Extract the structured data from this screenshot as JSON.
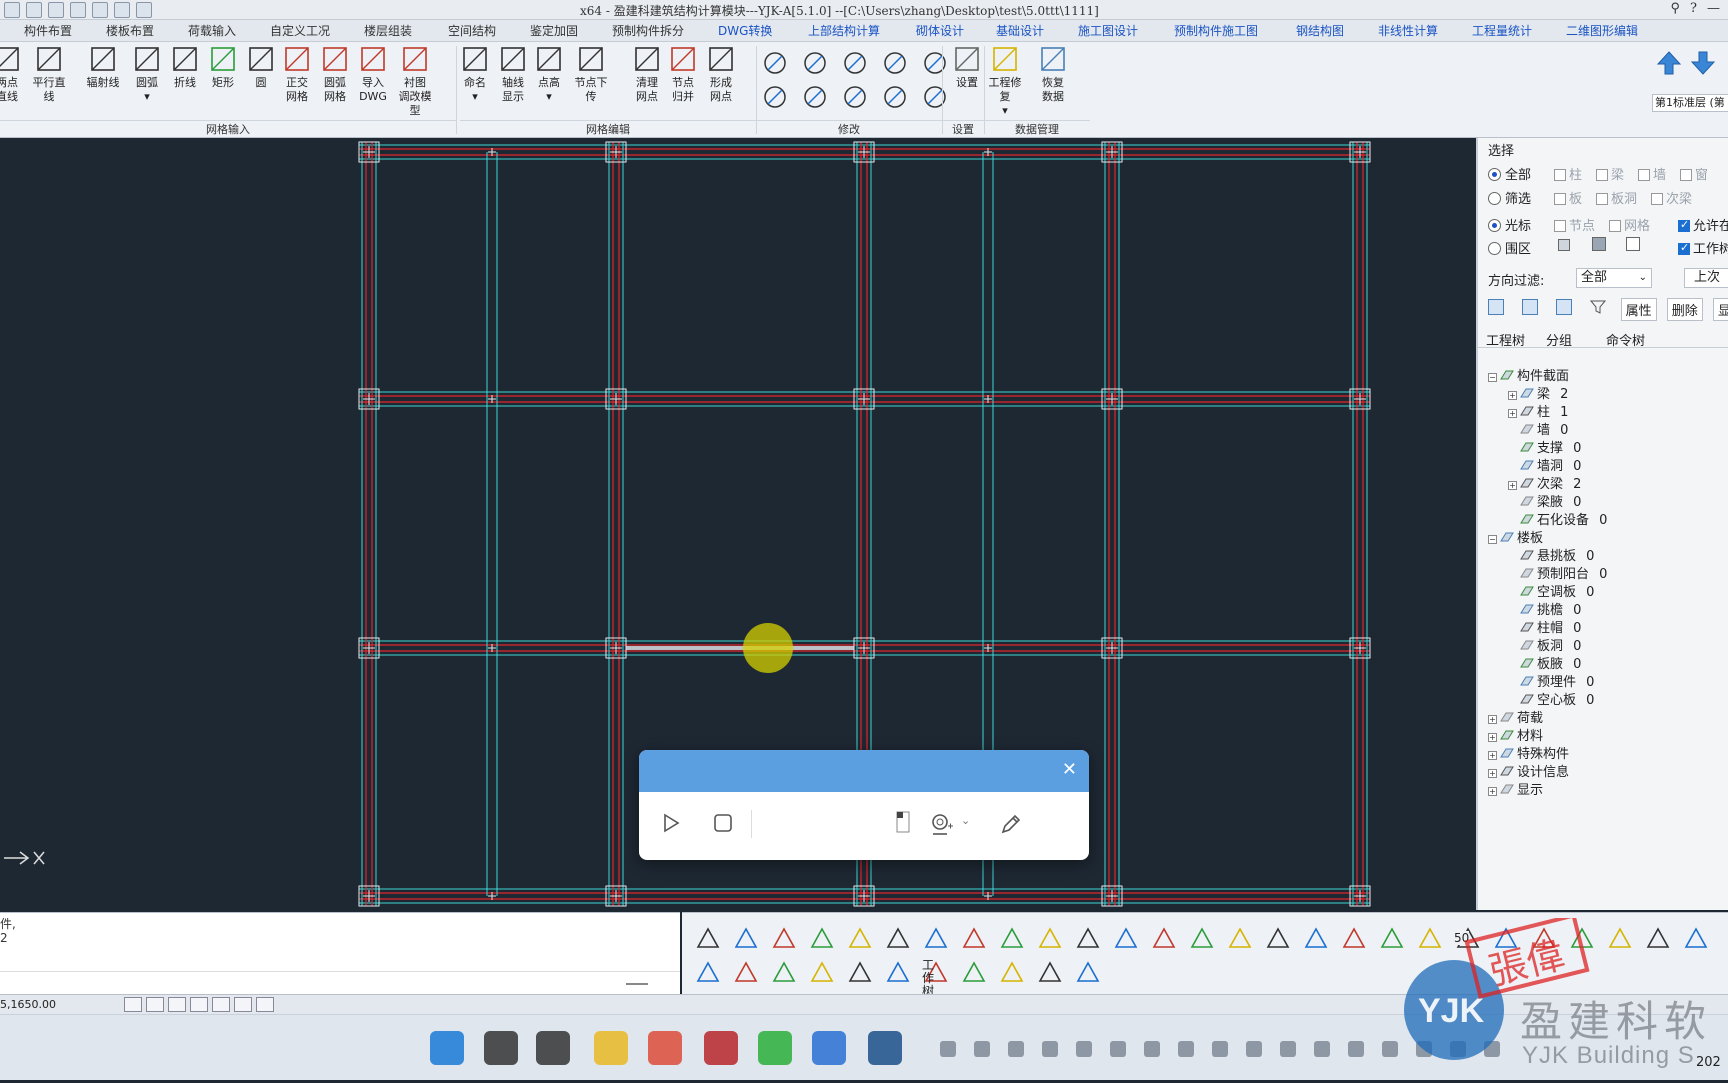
{
  "window": {
    "title": "x64 - 盈建科建筑结构计算模块---YJK-A[5.1.0] --[C:\\Users\\zhang\\Desktop\\test\\5.0ttt\\1111]"
  },
  "menu": [
    {
      "label": "构件布置",
      "active": false
    },
    {
      "label": "楼板布置",
      "active": false
    },
    {
      "label": "荷载输入",
      "active": false
    },
    {
      "label": "自定义工况",
      "active": false
    },
    {
      "label": "楼层组装",
      "active": false
    },
    {
      "label": "空间结构",
      "active": false
    },
    {
      "label": "鉴定加固",
      "active": false
    },
    {
      "label": "预制构件拆分",
      "active": false
    },
    {
      "label": "DWG转换",
      "active": true
    },
    {
      "label": "上部结构计算",
      "active": true
    },
    {
      "label": "砌体设计",
      "active": true
    },
    {
      "label": "基础设计",
      "active": true
    },
    {
      "label": "施工图设计",
      "active": true
    },
    {
      "label": "预制构件施工图",
      "active": true
    },
    {
      "label": "钢结构图",
      "active": true
    },
    {
      "label": "非线性计算",
      "active": true
    },
    {
      "label": "工程量统计",
      "active": true
    },
    {
      "label": "二维图形编辑",
      "active": true
    }
  ],
  "ribbon": {
    "tools": [
      {
        "id": "two-point-line",
        "label1": "两点",
        "label2": "直线"
      },
      {
        "id": "parallel-line",
        "label1": "平行直线",
        "label2": ""
      },
      {
        "id": "radial-line",
        "label1": "辐射线",
        "label2": ""
      },
      {
        "id": "arc",
        "label1": "圆弧",
        "label2": "▾"
      },
      {
        "id": "polyline",
        "label1": "折线",
        "label2": ""
      },
      {
        "id": "rectangle",
        "label1": "矩形",
        "label2": ""
      },
      {
        "id": "circle",
        "label1": "圆",
        "label2": ""
      },
      {
        "id": "ortho-grid",
        "label1": "正交",
        "label2": "网格"
      },
      {
        "id": "arc-grid",
        "label1": "圆弧",
        "label2": "网格"
      },
      {
        "id": "import-dwg",
        "label1": "导入",
        "label2": "DWG"
      },
      {
        "id": "base-model",
        "label1": "衬图",
        "label2": "调改模型"
      },
      {
        "id": "name",
        "label1": "命名",
        "label2": "▾"
      },
      {
        "id": "axis-display",
        "label1": "轴线",
        "label2": "显示"
      },
      {
        "id": "node-height",
        "label1": "点高",
        "label2": "▾"
      },
      {
        "id": "node-down",
        "label1": "节点下传",
        "label2": ""
      },
      {
        "id": "clean-grid",
        "label1": "清理",
        "label2": "网点"
      },
      {
        "id": "node-merge",
        "label1": "节点",
        "label2": "归并"
      },
      {
        "id": "form-grid",
        "label1": "形成",
        "label2": "网点"
      },
      {
        "id": "settings",
        "label1": "设置",
        "label2": ""
      },
      {
        "id": "project-repair",
        "label1": "工程修复",
        "label2": "▾"
      },
      {
        "id": "restore-data",
        "label1": "恢复",
        "label2": "数据"
      }
    ],
    "groups": [
      "网格输入",
      "网格编辑",
      "修改",
      "设置",
      "数据管理"
    ],
    "floor_label": "第1标准层 (第"
  },
  "panel": {
    "section_title": "选择",
    "mode_options": [
      {
        "label": "全部",
        "on": true
      },
      {
        "label": "筛选",
        "on": false
      },
      {
        "label": "光标",
        "on": true
      },
      {
        "label": "围区",
        "on": false
      }
    ],
    "type_checks_row1": [
      "柱",
      "梁",
      "墙",
      "窗"
    ],
    "type_checks_row2": [
      "板",
      "板洞",
      "次梁"
    ],
    "type_checks_row3": [
      "节点",
      "网格"
    ],
    "allow_label": "允许在",
    "work_label": "工作树",
    "direction_filter_label": "方向过滤:",
    "direction_filter_value": "全部",
    "prev_button": "上次",
    "attr_button": "属性",
    "delete_button": "删除",
    "show_button": "显",
    "tabs": [
      "工程树",
      "分组",
      "命令树"
    ],
    "tree": [
      {
        "level": 0,
        "pm": "−",
        "label": "构件截面",
        "count": ""
      },
      {
        "level": 1,
        "pm": "+",
        "label": "梁",
        "count": "2"
      },
      {
        "level": 1,
        "pm": "+",
        "label": "柱",
        "count": "1"
      },
      {
        "level": 1,
        "pm": "",
        "label": "墙",
        "count": "0"
      },
      {
        "level": 1,
        "pm": "",
        "label": "支撑",
        "count": "0"
      },
      {
        "level": 1,
        "pm": "",
        "label": "墙洞",
        "count": "0"
      },
      {
        "level": 1,
        "pm": "+",
        "label": "次梁",
        "count": "2"
      },
      {
        "level": 1,
        "pm": "",
        "label": "梁腋",
        "count": "0"
      },
      {
        "level": 1,
        "pm": "",
        "label": "石化设备",
        "count": "0"
      },
      {
        "level": 0,
        "pm": "−",
        "label": "楼板",
        "count": ""
      },
      {
        "level": 1,
        "pm": "",
        "label": "悬挑板",
        "count": "0"
      },
      {
        "level": 1,
        "pm": "",
        "label": "预制阳台",
        "count": "0"
      },
      {
        "level": 1,
        "pm": "",
        "label": "空调板",
        "count": "0"
      },
      {
        "level": 1,
        "pm": "",
        "label": "挑檐",
        "count": "0"
      },
      {
        "level": 1,
        "pm": "",
        "label": "柱帽",
        "count": "0"
      },
      {
        "level": 1,
        "pm": "",
        "label": "板洞",
        "count": "0"
      },
      {
        "level": 1,
        "pm": "",
        "label": "板腋",
        "count": "0"
      },
      {
        "level": 1,
        "pm": "",
        "label": "预埋件",
        "count": "0"
      },
      {
        "level": 1,
        "pm": "",
        "label": "空心板",
        "count": "0"
      },
      {
        "level": 0,
        "pm": "+",
        "label": "荷载",
        "count": ""
      },
      {
        "level": 0,
        "pm": "+",
        "label": "材料",
        "count": ""
      },
      {
        "level": 0,
        "pm": "+",
        "label": "特殊构件",
        "count": ""
      },
      {
        "level": 0,
        "pm": "+",
        "label": "设计信息",
        "count": ""
      },
      {
        "level": 0,
        "pm": "+",
        "label": "显示",
        "count": ""
      }
    ]
  },
  "command": {
    "line1": "件,",
    "line2": "2"
  },
  "status": {
    "coords": "5,1650.00"
  },
  "bottom_tools": {
    "workspace_label1": "工作",
    "workspace_label2": "树",
    "scale_label": "50"
  },
  "watermark": {
    "brand_cn": "盈建科软",
    "brand_en": "YJK Building S",
    "seal": "張偉"
  },
  "taskbar": {
    "time": "202"
  },
  "colors": {
    "canvas_bg": "#1e2833",
    "grid_cyan": "#3fd6d6",
    "beam_red": "#e0242c",
    "node_white": "#e8e8e8",
    "menu_active": "#1a53c4",
    "dialog_header": "#5b9fe0",
    "cursor_highlight": "#d4d000"
  }
}
